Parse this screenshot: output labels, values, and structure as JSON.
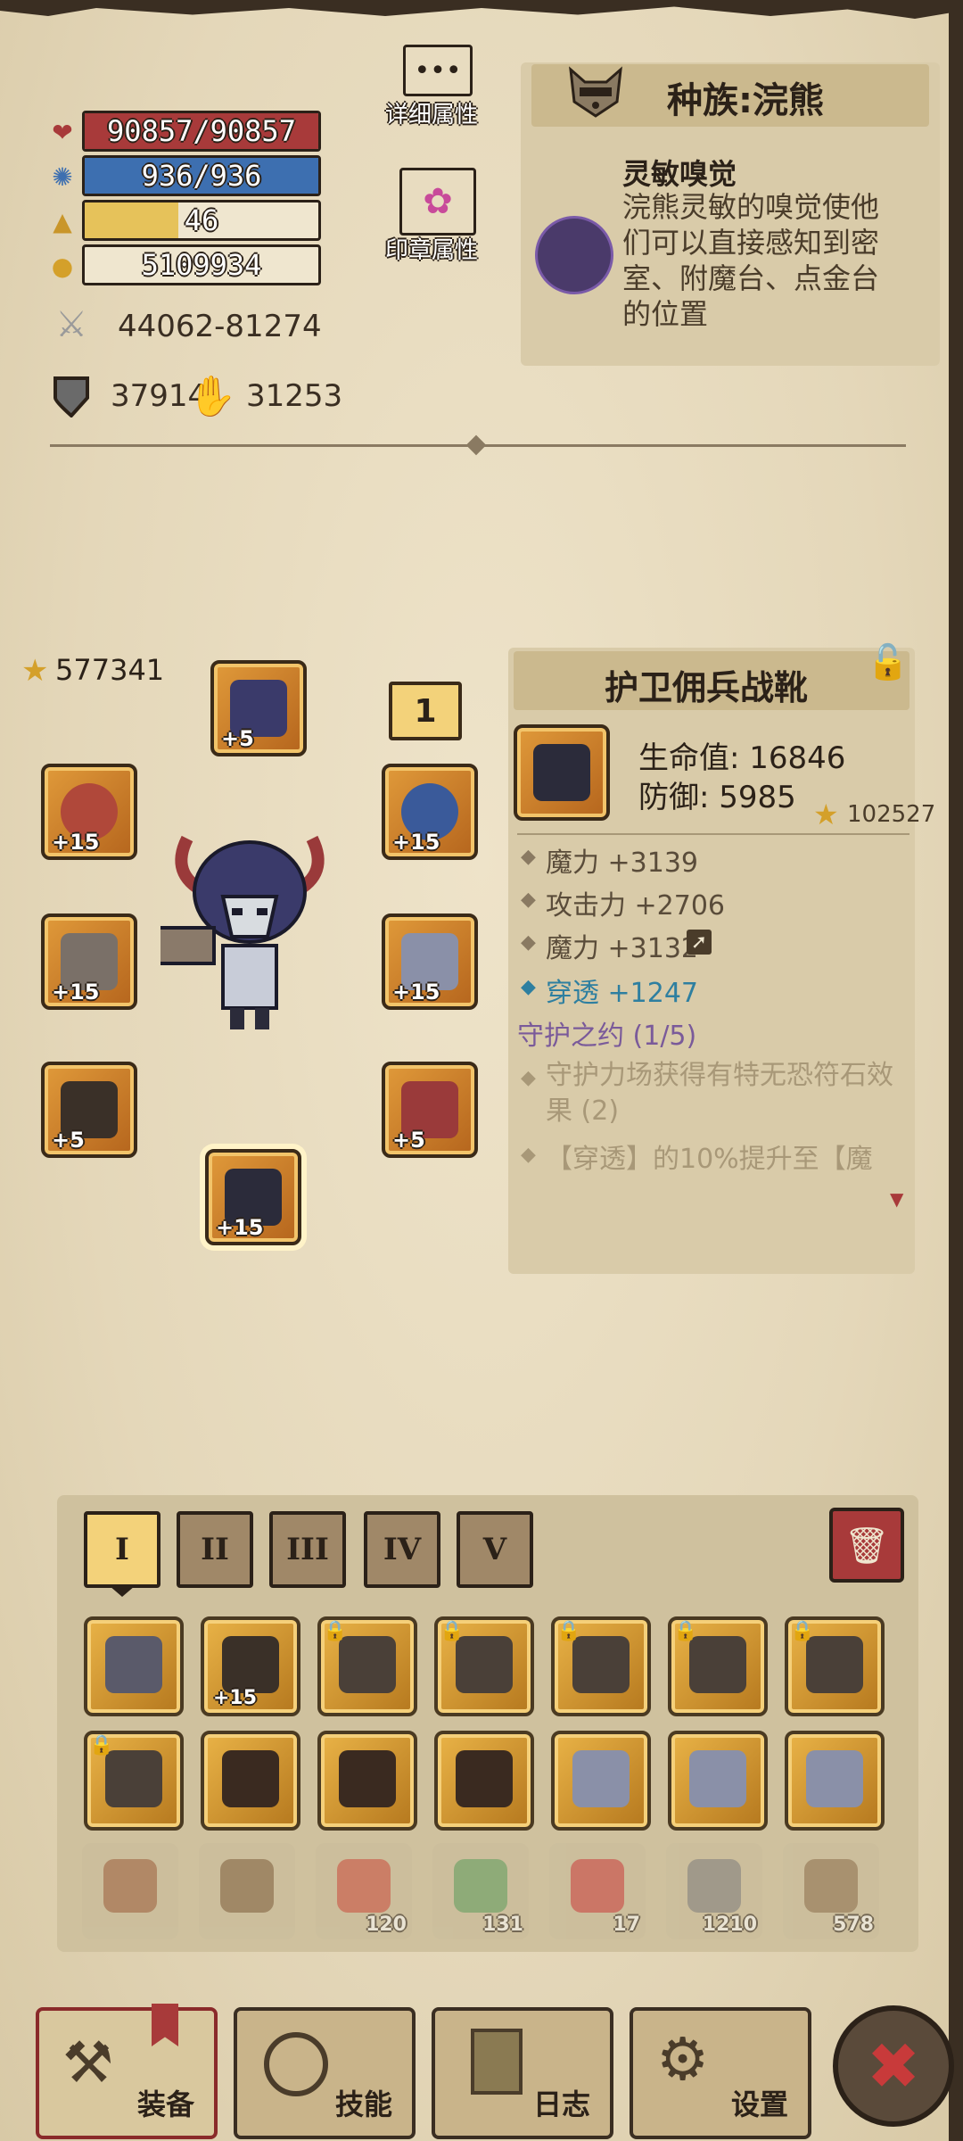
{
  "stats": {
    "hp": "90857/90857",
    "mp": "936/936",
    "level": "46",
    "gold": "5109934",
    "attack": "44062-81274",
    "defense": "37914",
    "gold_rate": "31253",
    "hp_fraction": 1.0,
    "mp_fraction": 1.0,
    "level_fraction": 0.4
  },
  "side_buttons": {
    "detail_label": "详细属性",
    "seal_label": "印章属性"
  },
  "race": {
    "title": "种族:浣熊",
    "trait_title": "灵敏嗅觉",
    "trait_desc": "浣熊灵敏的嗅觉使他们可以直接感知到密室、附魔台、点金台的位置"
  },
  "equip": {
    "total_score": "577341",
    "slot_counter": "1",
    "slots": [
      {
        "name": "helmet",
        "level": "+5"
      },
      {
        "name": "amulet",
        "level": "+15"
      },
      {
        "name": "weapon",
        "level": "+15"
      },
      {
        "name": "ring",
        "level": "+15"
      },
      {
        "name": "shoulder",
        "level": "+15"
      },
      {
        "name": "gloves",
        "level": "+5"
      },
      {
        "name": "belt",
        "level": "+5"
      },
      {
        "name": "boots",
        "level": "+15"
      }
    ]
  },
  "item": {
    "name": "护卫佣兵战靴",
    "hp_label": "生命值: 16846",
    "def_label": "防御: 5985",
    "score": "102527",
    "attrs": [
      "魔力 +3139",
      "攻击力 +2706",
      "魔力 +3132"
    ],
    "special_attr": "穿透 +1247",
    "set_name": "守护之约 (1/5)",
    "set_effect_1": "守护力场获得有特无恐符石效果 (2)",
    "set_effect_2": "【穿透】的10%提升至【魔"
  },
  "tabs": [
    "I",
    "II",
    "III",
    "IV",
    "V"
  ],
  "inventory": [
    {
      "kind": "sword",
      "level": "",
      "locked": false
    },
    {
      "kind": "spiked-club",
      "level": "+15",
      "locked": false
    },
    {
      "kind": "helmet",
      "level": "",
      "locked": true
    },
    {
      "kind": "helmet",
      "level": "",
      "locked": true
    },
    {
      "kind": "helmet",
      "level": "",
      "locked": true
    },
    {
      "kind": "helmet",
      "level": "",
      "locked": true
    },
    {
      "kind": "helmet",
      "level": "",
      "locked": true
    },
    {
      "kind": "helmet",
      "level": "",
      "locked": true
    },
    {
      "kind": "armor",
      "level": "",
      "locked": false
    },
    {
      "kind": "armor",
      "level": "",
      "locked": false
    },
    {
      "kind": "armor",
      "level": "",
      "locked": false
    },
    {
      "kind": "wings",
      "level": "",
      "locked": false
    },
    {
      "kind": "wings",
      "level": "",
      "locked": false
    },
    {
      "kind": "wings",
      "level": "",
      "locked": false
    }
  ],
  "consumables": [
    {
      "kind": "red-book",
      "count": ""
    },
    {
      "kind": "green-book",
      "count": ""
    },
    {
      "kind": "red-potion",
      "count": "120"
    },
    {
      "kind": "green-potion",
      "count": "131"
    },
    {
      "kind": "apple",
      "count": "17"
    },
    {
      "kind": "stone-blocks",
      "count": "1210"
    },
    {
      "kind": "scrap",
      "count": "578"
    }
  ],
  "nav": {
    "equip": "装备",
    "skills": "技能",
    "log": "日志",
    "settings": "设置"
  },
  "colors": {
    "hp": "#a83a3a",
    "mp": "#3d6fb0",
    "xp": "#e6c25a",
    "gold_bar": "#efe6cf",
    "penetration": "#2e7fa0",
    "set": "#7a5a9a"
  }
}
